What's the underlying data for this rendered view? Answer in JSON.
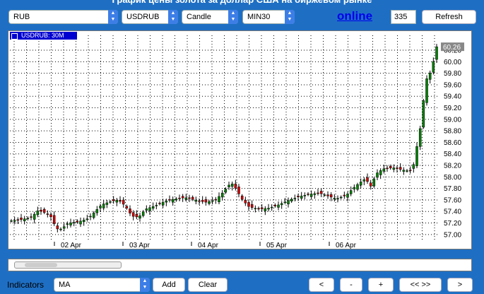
{
  "header": {
    "title": "График цены золота за доллар США на биржевом рынке",
    "currency_select": "RUB",
    "symbol_select": "USDRUB",
    "type_select": "Candle",
    "period_select": "MIN30",
    "online_link": "online",
    "bar_count": "335",
    "refresh_label": "Refresh"
  },
  "chart": {
    "symbol_tag": "USDRUB: 30M",
    "last_price": "60.26"
  },
  "chart_data": {
    "type": "candlestick",
    "x_ticks": [
      "02 Apr",
      "03 Apr",
      "04 Apr",
      "05 Apr",
      "06 Apr"
    ],
    "y_ticks": [
      "57.00",
      "57.20",
      "57.40",
      "57.60",
      "57.80",
      "58.00",
      "58.20",
      "58.40",
      "58.60",
      "58.80",
      "59.00",
      "59.20",
      "59.40",
      "59.60",
      "59.80",
      "60.00",
      "60.20"
    ],
    "ylim": [
      56.9,
      60.36
    ],
    "grid": true,
    "close_path": [
      {
        "x": 0,
        "y": 57.24
      },
      {
        "x": 3,
        "y": 57.26
      },
      {
        "x": 6,
        "y": 57.3
      },
      {
        "x": 8,
        "y": 57.42
      },
      {
        "x": 10,
        "y": 57.38
      },
      {
        "x": 12,
        "y": 57.3
      },
      {
        "x": 13,
        "y": 57.16
      },
      {
        "x": 14,
        "y": 57.08
      },
      {
        "x": 15,
        "y": 57.1
      },
      {
        "x": 17,
        "y": 57.2
      },
      {
        "x": 20,
        "y": 57.22
      },
      {
        "x": 23,
        "y": 57.28
      },
      {
        "x": 25,
        "y": 57.4
      },
      {
        "x": 27,
        "y": 57.52
      },
      {
        "x": 30,
        "y": 57.58
      },
      {
        "x": 32,
        "y": 57.6
      },
      {
        "x": 34,
        "y": 57.5
      },
      {
        "x": 36,
        "y": 57.32
      },
      {
        "x": 38,
        "y": 57.3
      },
      {
        "x": 40,
        "y": 57.44
      },
      {
        "x": 43,
        "y": 57.5
      },
      {
        "x": 46,
        "y": 57.58
      },
      {
        "x": 49,
        "y": 57.62
      },
      {
        "x": 52,
        "y": 57.64
      },
      {
        "x": 55,
        "y": 57.6
      },
      {
        "x": 58,
        "y": 57.56
      },
      {
        "x": 61,
        "y": 57.6
      },
      {
        "x": 63,
        "y": 57.72
      },
      {
        "x": 65,
        "y": 57.86
      },
      {
        "x": 66,
        "y": 57.88
      },
      {
        "x": 67,
        "y": 57.8
      },
      {
        "x": 69,
        "y": 57.6
      },
      {
        "x": 71,
        "y": 57.48
      },
      {
        "x": 74,
        "y": 57.44
      },
      {
        "x": 77,
        "y": 57.46
      },
      {
        "x": 80,
        "y": 57.52
      },
      {
        "x": 83,
        "y": 57.6
      },
      {
        "x": 86,
        "y": 57.66
      },
      {
        "x": 89,
        "y": 57.7
      },
      {
        "x": 92,
        "y": 57.72
      },
      {
        "x": 95,
        "y": 57.66
      },
      {
        "x": 97,
        "y": 57.62
      },
      {
        "x": 100,
        "y": 57.68
      },
      {
        "x": 102,
        "y": 57.8
      },
      {
        "x": 104,
        "y": 57.9
      },
      {
        "x": 106,
        "y": 57.98
      },
      {
        "x": 107,
        "y": 57.8
      },
      {
        "x": 109,
        "y": 58.06
      },
      {
        "x": 111,
        "y": 58.14
      },
      {
        "x": 114,
        "y": 58.16
      },
      {
        "x": 117,
        "y": 58.12
      },
      {
        "x": 119,
        "y": 58.1
      },
      {
        "x": 120,
        "y": 58.18
      },
      {
        "x": 121,
        "y": 58.5
      },
      {
        "x": 122,
        "y": 58.8
      },
      {
        "x": 123,
        "y": 59.3
      },
      {
        "x": 124,
        "y": 59.7
      },
      {
        "x": 125,
        "y": 59.8
      },
      {
        "x": 126,
        "y": 60.0
      },
      {
        "x": 127,
        "y": 60.26
      }
    ]
  },
  "indicators": {
    "label": "Indicators",
    "select": "MA",
    "add_label": "Add",
    "clear_label": "Clear",
    "nav_prev": "<",
    "nav_zoom_out": "-",
    "nav_zoom_in": "+",
    "nav_range": "<< >>",
    "nav_next": ">"
  }
}
